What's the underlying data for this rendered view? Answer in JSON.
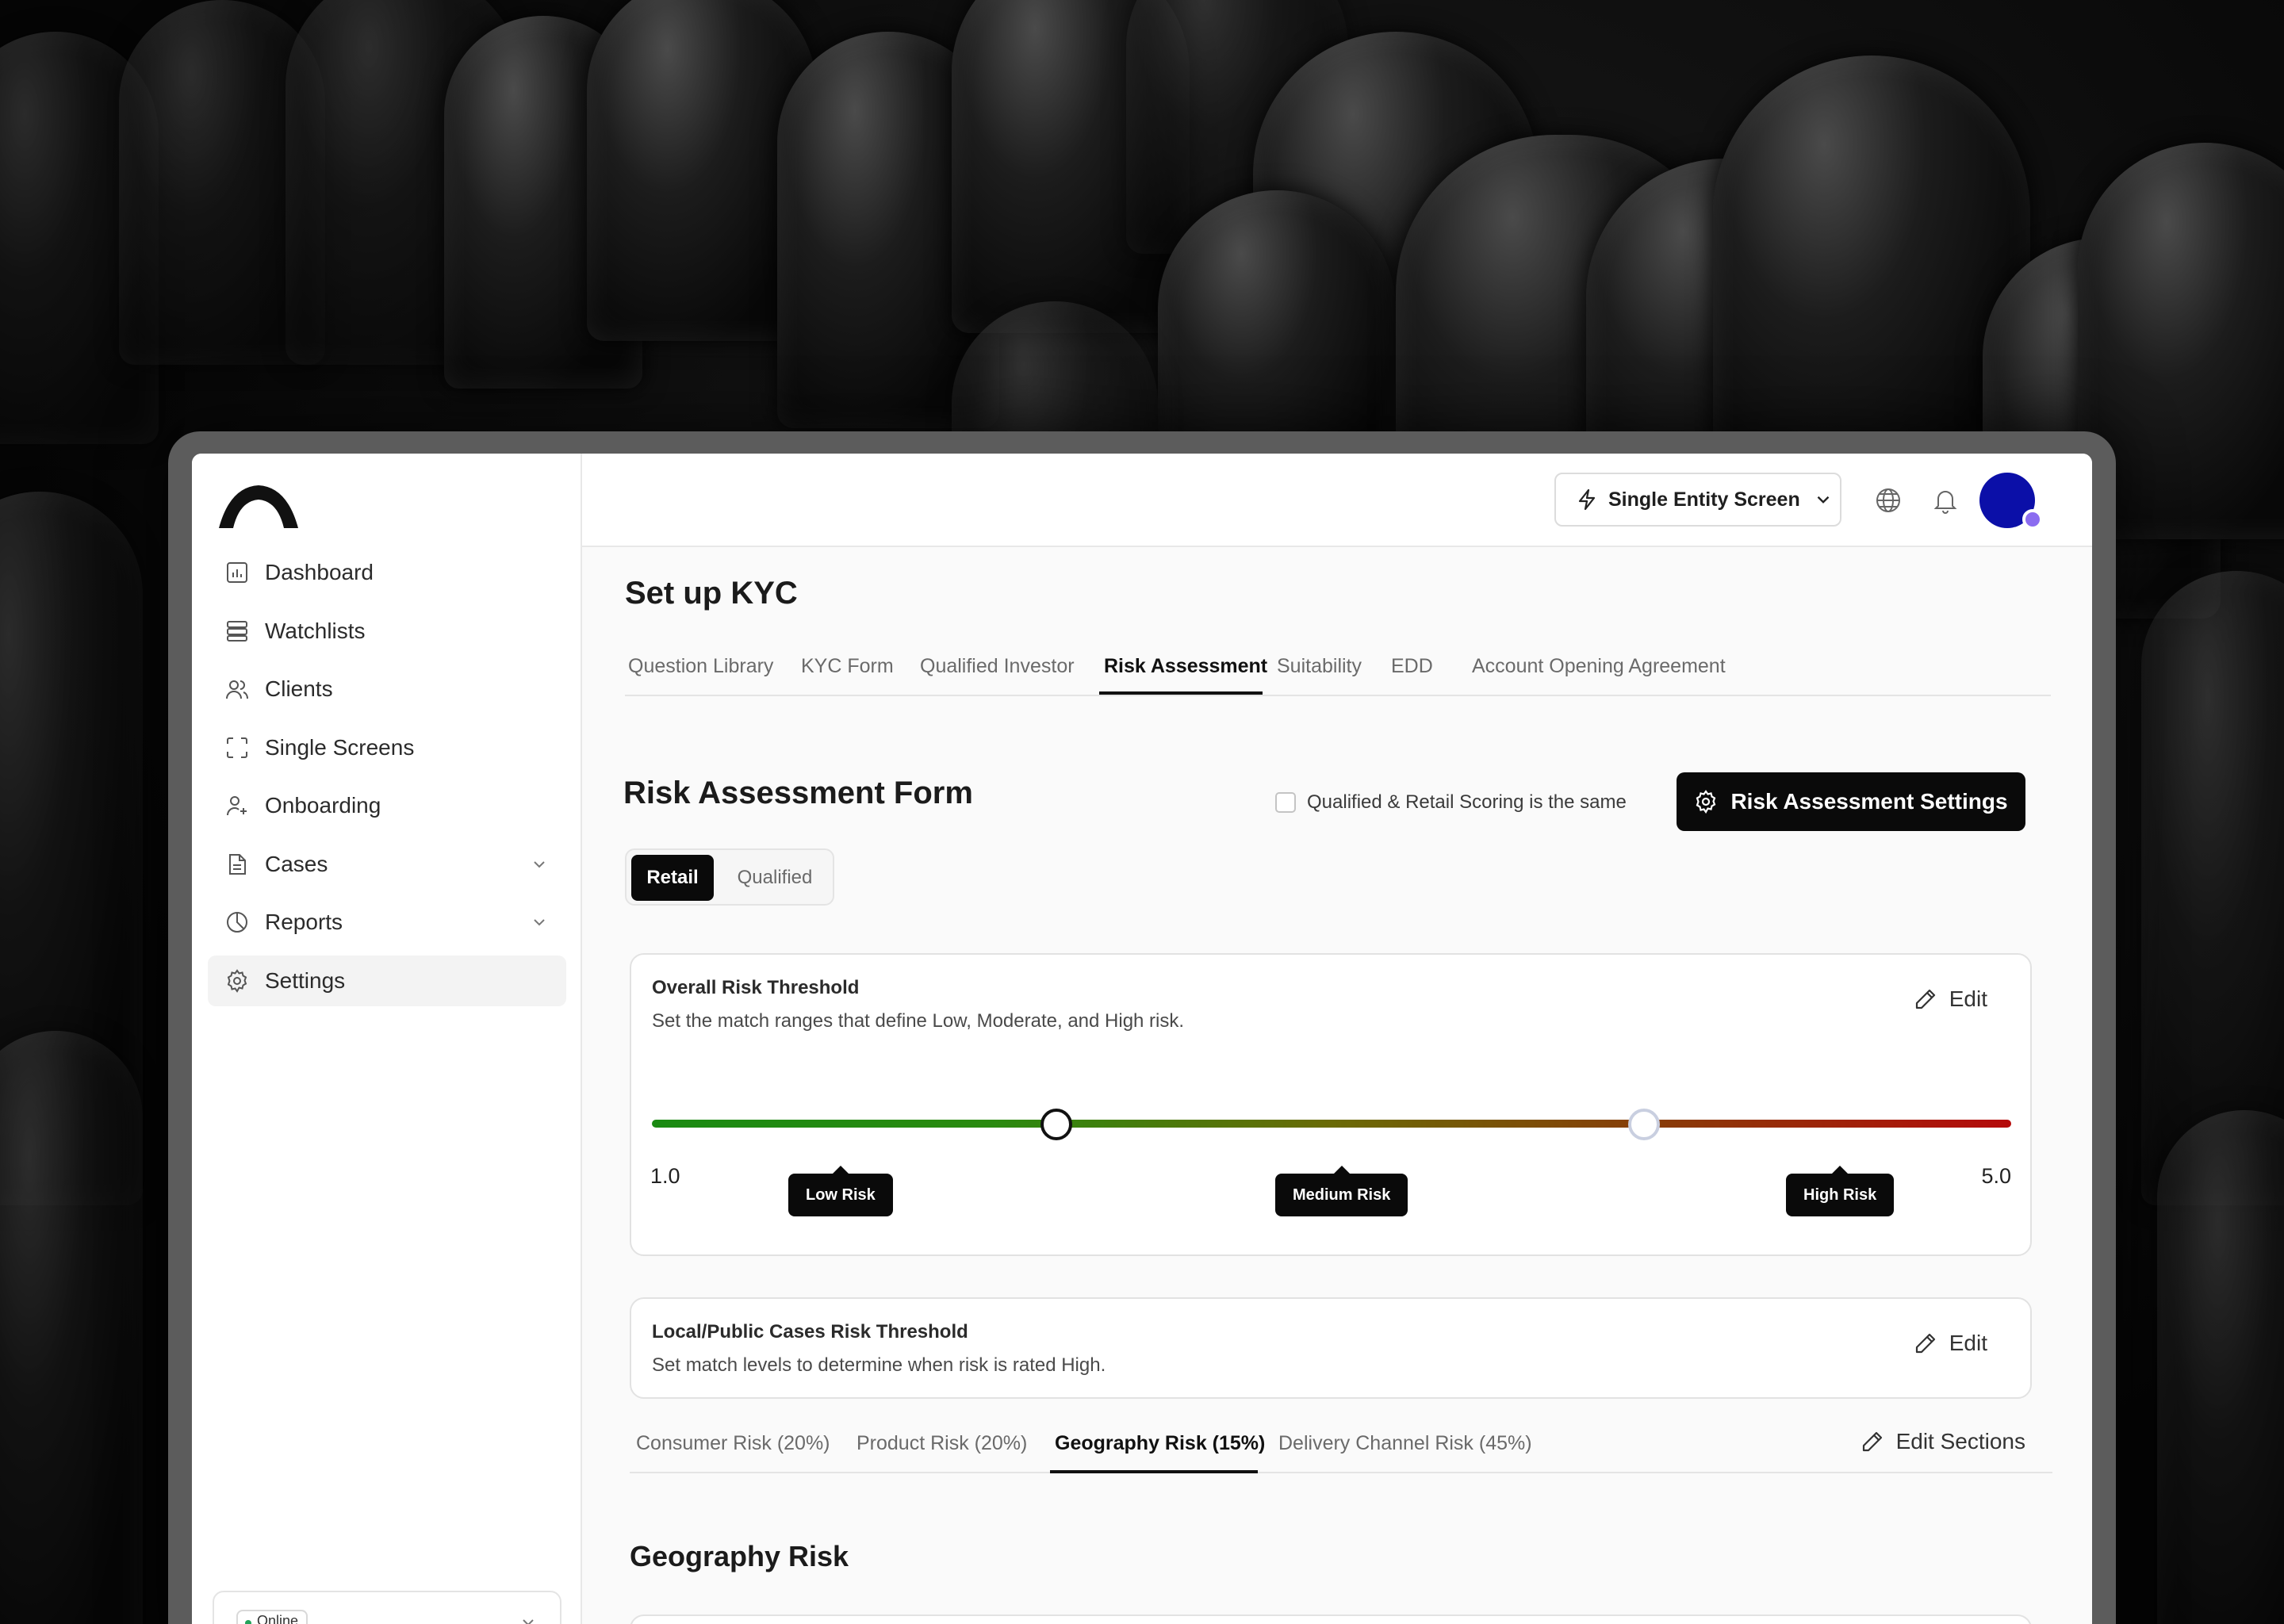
{
  "app": {
    "sidebar": {
      "items": [
        {
          "label": "Dashboard",
          "icon": "chart-icon"
        },
        {
          "label": "Watchlists",
          "icon": "list-icon"
        },
        {
          "label": "Clients",
          "icon": "users-icon"
        },
        {
          "label": "Single Screens",
          "icon": "scan-icon"
        },
        {
          "label": "Onboarding",
          "icon": "user-plus-icon"
        },
        {
          "label": "Cases",
          "icon": "document-icon",
          "expandable": true
        },
        {
          "label": "Reports",
          "icon": "pie-chart-icon",
          "expandable": true
        },
        {
          "label": "Settings",
          "icon": "gear-icon",
          "active": true
        }
      ],
      "status": "Online"
    },
    "topbar": {
      "entity_button": "Single Entity Screen",
      "avatar_color": "#0b0fa8"
    },
    "page_title": "Set up KYC",
    "tabs": [
      {
        "label": "Question Library"
      },
      {
        "label": "KYC Form"
      },
      {
        "label": "Qualified Investor"
      },
      {
        "label": "Risk Assessment",
        "active": true
      },
      {
        "label": "Suitability"
      },
      {
        "label": "EDD"
      },
      {
        "label": "Account Opening Agreement"
      }
    ],
    "form": {
      "title": "Risk Assessment Form",
      "same_scoring_label": "Qualified & Retail Scoring is the same",
      "same_scoring_checked": false,
      "settings_button": "Risk Assessment Settings",
      "segments": [
        {
          "label": "Retail",
          "active": true
        },
        {
          "label": "Qualified",
          "active": false
        }
      ]
    },
    "overall_threshold": {
      "title": "Overall Risk Threshold",
      "subtitle": "Set the match ranges that define Low, Moderate, and High risk.",
      "edit_label": "Edit",
      "min_label": "1.0",
      "max_label": "5.0",
      "min": 1.0,
      "max": 5.0,
      "low_handle": 2.19,
      "high_handle": 3.92,
      "tooltips": [
        "Low Risk",
        "Medium Risk",
        "High Risk"
      ],
      "colors": {
        "low": "#1a8a12",
        "high": "#b50a0a"
      }
    },
    "local_threshold": {
      "title": "Local/Public Cases Risk Threshold",
      "subtitle": "Set match levels to determine when risk is rated High.",
      "edit_label": "Edit"
    },
    "risk_tabs": [
      {
        "label": "Consumer Risk (20%)"
      },
      {
        "label": "Product Risk (20%)"
      },
      {
        "label": "Geography Risk (15%)",
        "active": true
      },
      {
        "label": "Delivery Channel Risk (45%)"
      }
    ],
    "edit_sections_label": "Edit Sections",
    "section_title": "Geography Risk"
  }
}
